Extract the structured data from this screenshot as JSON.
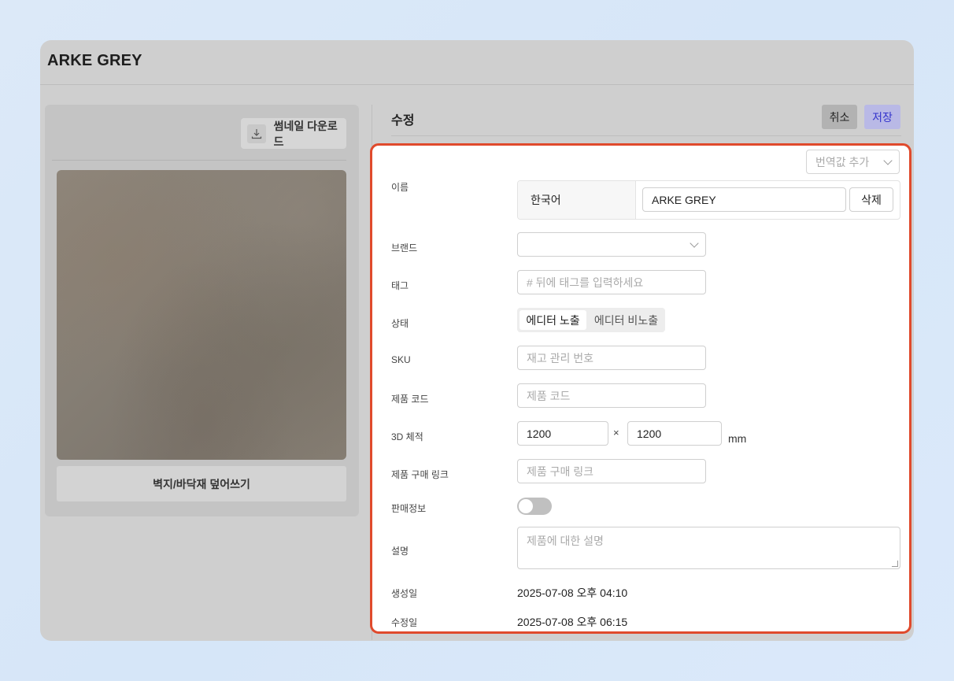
{
  "window": {
    "title": "ARKE GREY"
  },
  "left": {
    "thumbnail_download_label": "썸네일 다운로드",
    "overwrite_label": "벽지/바닥재 덮어쓰기"
  },
  "edit": {
    "title": "수정",
    "cancel_label": "취소",
    "save_label": "저장"
  },
  "form": {
    "translate_placeholder": "번역값 추가",
    "name": {
      "label": "이름",
      "language": "한국어",
      "value": "ARKE GREY",
      "delete_label": "삭제"
    },
    "brand": {
      "label": "브랜드",
      "value": ""
    },
    "tag": {
      "label": "태그",
      "placeholder": "# 뒤에 태그를 입력하세요"
    },
    "status": {
      "label": "상태",
      "options": [
        "에디터 노출",
        "에디터 비노출"
      ],
      "selected": "에디터 노출"
    },
    "sku": {
      "label": "SKU",
      "placeholder": "재고 관리 번호"
    },
    "product_code": {
      "label": "제품 코드",
      "placeholder": "제품 코드"
    },
    "dimensions": {
      "label": "3D 체적",
      "width": "1200",
      "height": "1200",
      "separator": "×",
      "unit": "mm"
    },
    "purchase_link": {
      "label": "제품 구매 링크",
      "placeholder": "제품 구매 링크"
    },
    "sales_info": {
      "label": "판매정보",
      "enabled": false
    },
    "description": {
      "label": "설명",
      "placeholder": "제품에 대한 설명"
    },
    "created": {
      "label": "생성일",
      "value": "2025-07-08 오후 04:10"
    },
    "modified": {
      "label": "수정일",
      "value": "2025-07-08 오후 06:15"
    }
  },
  "colors": {
    "highlight_border": "#e04a2c",
    "save_text": "#3434cc",
    "save_bg": "#b9b9e6"
  }
}
